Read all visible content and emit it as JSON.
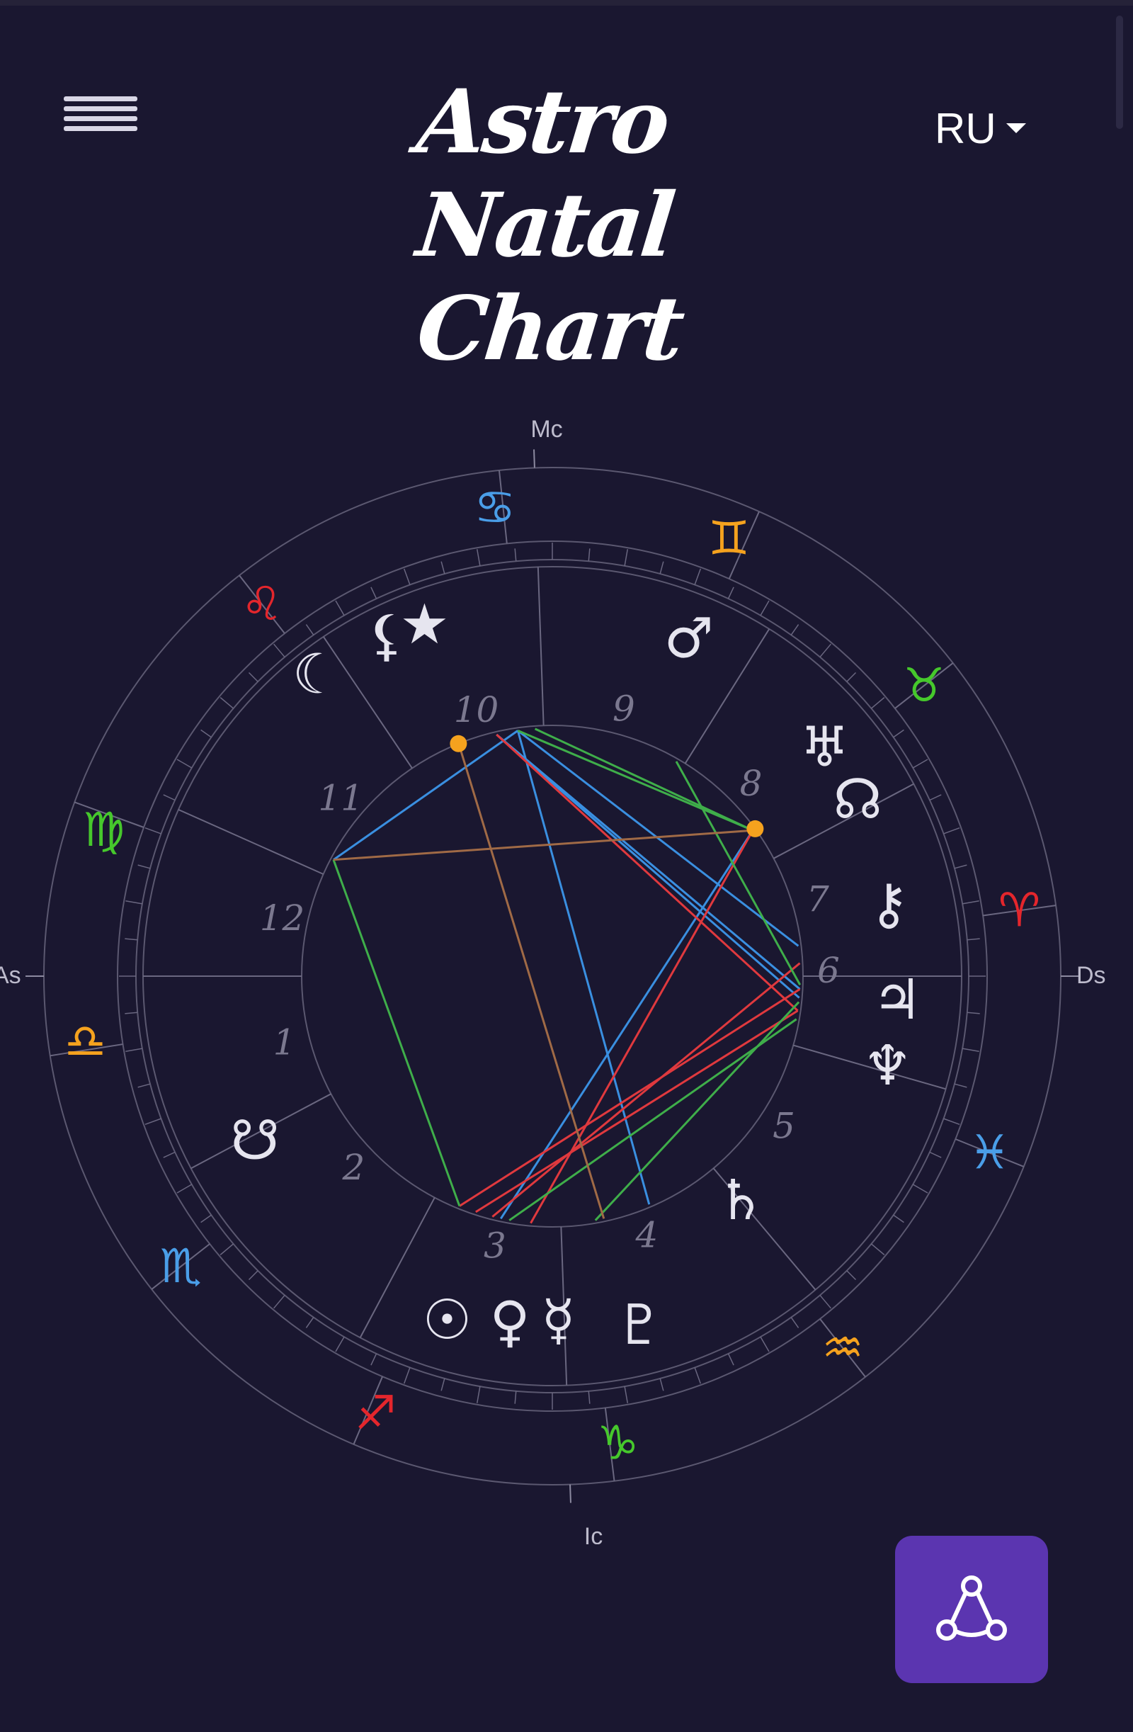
{
  "header": {
    "logo_lines": [
      "Astro",
      "Natal",
      "Chart"
    ],
    "language": "RU"
  },
  "icons": {
    "menu": "hamburger-menu-icon",
    "language_caret": "caret-down-icon",
    "aspects_button": "triangle-network-icon"
  },
  "chart": {
    "angle_labels": {
      "mc": "Mc",
      "ic": "Ic",
      "as": "As",
      "ds": "Ds"
    },
    "signs": [
      {
        "id": "cancer",
        "glyph": "♋",
        "color": "#4a9ee8"
      },
      {
        "id": "gemini",
        "glyph": "♊",
        "color": "#f5a21e"
      },
      {
        "id": "taurus",
        "glyph": "♉",
        "color": "#46c82c"
      },
      {
        "id": "aries",
        "glyph": "♈",
        "color": "#e4262c"
      },
      {
        "id": "pisces",
        "glyph": "♓",
        "color": "#4a9ee8"
      },
      {
        "id": "aquarius",
        "glyph": "♒",
        "color": "#f5a21e"
      },
      {
        "id": "capricorn",
        "glyph": "♑",
        "color": "#46c82c"
      },
      {
        "id": "sagittarius",
        "glyph": "♐",
        "color": "#e4262c"
      },
      {
        "id": "scorpio",
        "glyph": "♏",
        "color": "#4a9ee8"
      },
      {
        "id": "libra",
        "glyph": "♎",
        "color": "#f5a21e"
      },
      {
        "id": "virgo",
        "glyph": "♍",
        "color": "#46c82c"
      },
      {
        "id": "leo",
        "glyph": "♌",
        "color": "#e4262c"
      }
    ],
    "houses": [
      "1",
      "2",
      "3",
      "4",
      "5",
      "6",
      "7",
      "8",
      "9",
      "10",
      "11",
      "12"
    ],
    "planets": [
      {
        "id": "moon",
        "glyph": "☾"
      },
      {
        "id": "lilith",
        "glyph": "⚸"
      },
      {
        "id": "star",
        "glyph": "★"
      },
      {
        "id": "mars",
        "glyph": "♂"
      },
      {
        "id": "uranus",
        "glyph": "♅"
      },
      {
        "id": "north-node",
        "glyph": "☊"
      },
      {
        "id": "chiron",
        "glyph": "⚷"
      },
      {
        "id": "jupiter",
        "glyph": "♃"
      },
      {
        "id": "neptune",
        "glyph": "♆"
      },
      {
        "id": "saturn",
        "glyph": "♄"
      },
      {
        "id": "pluto",
        "glyph": "♇"
      },
      {
        "id": "mercury",
        "glyph": "☿"
      },
      {
        "id": "venus",
        "glyph": "♀"
      },
      {
        "id": "sun",
        "glyph": "☉"
      },
      {
        "id": "south-node",
        "glyph": "☋"
      }
    ],
    "aspect_colors": {
      "blue": "#3a8fe0",
      "red": "#e0393e",
      "green": "#3fae4a",
      "brown": "#a06a46"
    }
  }
}
